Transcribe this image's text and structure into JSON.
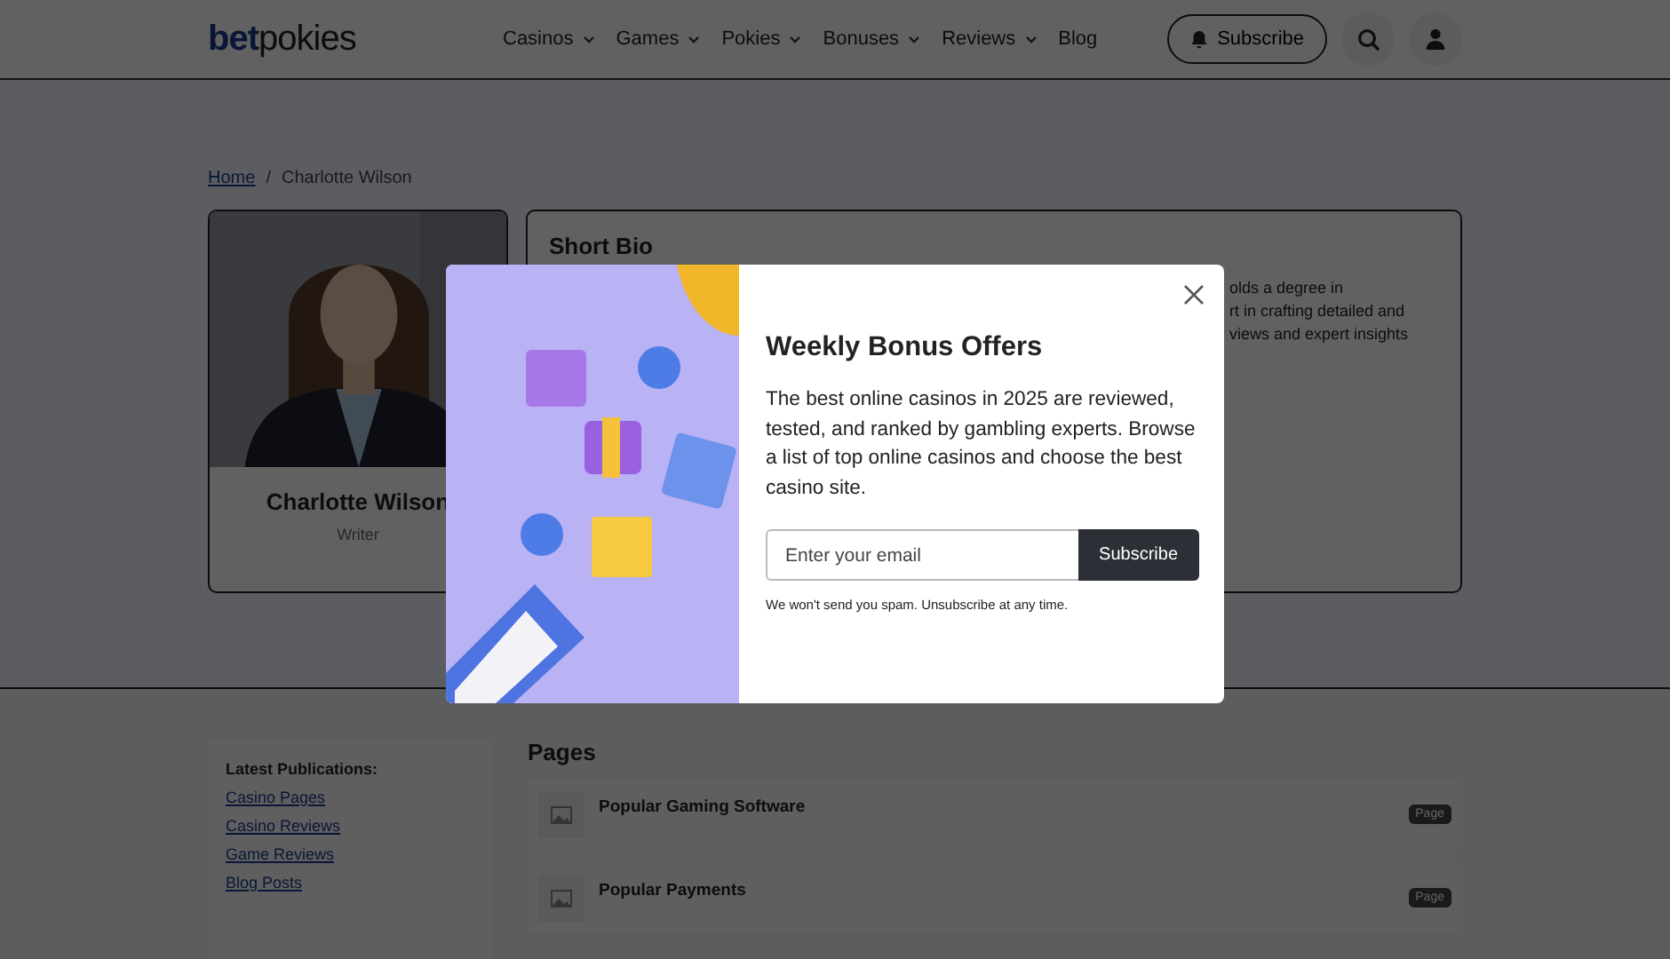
{
  "header": {
    "logo": {
      "first": "bet",
      "second": "pokies"
    },
    "nav": [
      {
        "label": "Casinos",
        "dropdown": true
      },
      {
        "label": "Games",
        "dropdown": true
      },
      {
        "label": "Pokies",
        "dropdown": true
      },
      {
        "label": "Bonuses",
        "dropdown": true
      },
      {
        "label": "Reviews",
        "dropdown": true
      },
      {
        "label": "Blog",
        "dropdown": false
      }
    ],
    "subscribe_button": "Subscribe"
  },
  "breadcrumb": {
    "separator": "/",
    "items": [
      "Home",
      "Charlotte Wilson"
    ]
  },
  "profile": {
    "name": "Charlotte Wilson",
    "role": "Writer"
  },
  "bio": {
    "title": "Short Bio",
    "lines": [
      "olds a degree in",
      "rt in crafting detailed and",
      "views and expert insights"
    ]
  },
  "modal": {
    "title": "Weekly Bonus Offers",
    "text": "The best online casinos in 2025 are reviewed, tested, and ranked by gambling experts. Browse a list of top online casinos and choose the best casino site.",
    "email": {
      "placeholder": "Enter your email"
    },
    "button": "Subscribe",
    "note": "We won't send you spam. Unsubscribe at any time."
  },
  "sidebar": {
    "title": "Latest Publications:",
    "links": [
      "Casino Pages",
      "Casino Reviews",
      "Game Reviews",
      "Blog Posts"
    ]
  },
  "pages": {
    "title": "Pages",
    "items": [
      {
        "title": "Popular Gaming Software",
        "badge": "Page"
      },
      {
        "title": "Popular Payments",
        "badge": "Page"
      }
    ]
  }
}
